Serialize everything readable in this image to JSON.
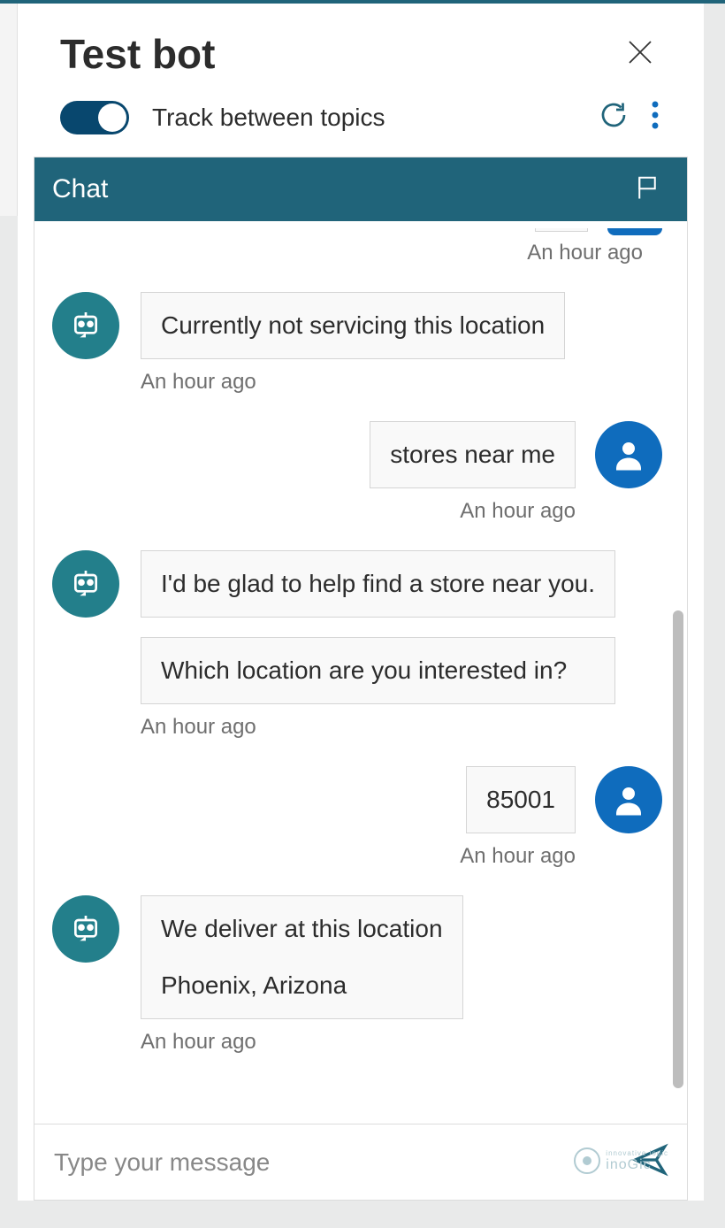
{
  "header": {
    "title": "Test bot",
    "track_label": "Track between topics",
    "toggle_on": true
  },
  "chat": {
    "header": "Chat",
    "input_placeholder": "Type your message",
    "groups": [
      {
        "type": "user-partial",
        "time": "An hour ago"
      },
      {
        "type": "bot",
        "messages": [
          "Currently not servicing this location"
        ],
        "time": "An hour ago"
      },
      {
        "type": "user",
        "messages": [
          "stores near me"
        ],
        "time": "An hour ago"
      },
      {
        "type": "bot",
        "messages": [
          "I'd be glad to help find a store near you.",
          "Which location are you interested in?"
        ],
        "time": "An hour ago"
      },
      {
        "type": "user",
        "messages": [
          "85001"
        ],
        "time": "An hour ago"
      },
      {
        "type": "bot",
        "messages": [
          "We deliver at this location\nPhoenix, Arizona"
        ],
        "time": "An hour ago"
      }
    ]
  },
  "watermark": {
    "tagline": "innovative logic",
    "brand": "inoGic"
  }
}
